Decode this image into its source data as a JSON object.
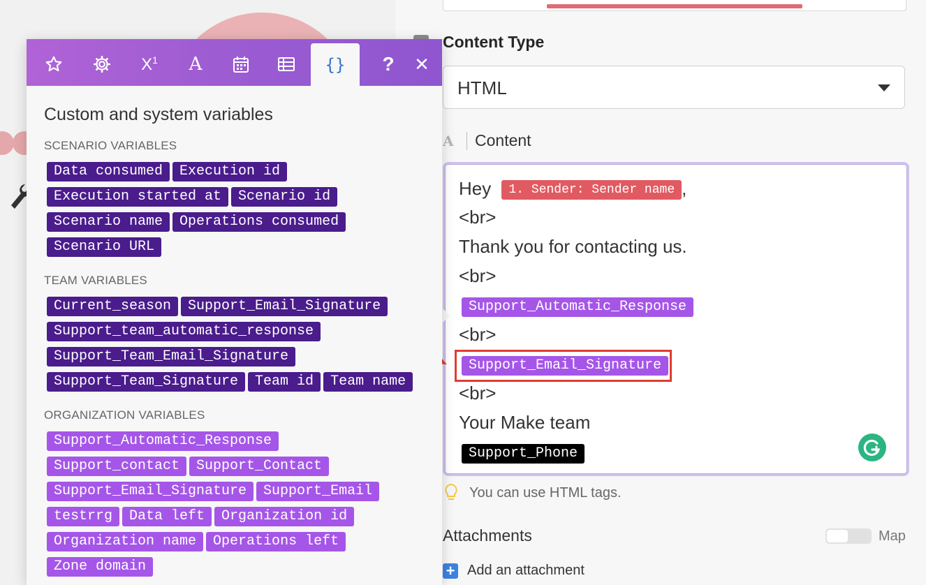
{
  "colors": {
    "scenario_pill": "#4a1c8c",
    "team_pill": "#4a1c8c",
    "org_pill": "#a556e8",
    "sender_pill": "#e15a61",
    "phone_pill": "#000000",
    "highlight": "#e03c31",
    "toolbar_gradient_start": "#b063d6",
    "toolbar_gradient_end": "#8f56cf"
  },
  "variables_panel": {
    "toolbar_icons": [
      "star-icon",
      "gear-icon",
      "superscript-icon",
      "text-icon",
      "calendar-icon",
      "table-icon",
      "braces-icon",
      "help-icon",
      "close-icon"
    ],
    "title": "Custom and system variables",
    "scenario": {
      "heading": "SCENARIO VARIABLES",
      "rows": [
        [
          "Data consumed",
          "Execution id"
        ],
        [
          "Execution started at",
          "Scenario id"
        ],
        [
          "Scenario name",
          "Operations consumed"
        ],
        [
          "Scenario URL"
        ]
      ]
    },
    "team": {
      "heading": "TEAM VARIABLES",
      "rows": [
        [
          "Current_season",
          "Support_Email_Signature"
        ],
        [
          "Support_team_automatic_response"
        ],
        [
          "Support_Team_Email_Signature"
        ],
        [
          "Support_Team_Signature",
          "Team id",
          "Team name"
        ]
      ]
    },
    "organization": {
      "heading": "ORGANIZATION VARIABLES",
      "rows": [
        [
          "Support_Automatic_Response"
        ],
        [
          "Support_contact",
          "Support_Contact"
        ],
        [
          "Support_Email_Signature",
          "Support_Email"
        ],
        [
          "testrrg",
          "Data left",
          "Organization id"
        ],
        [
          "Organization name",
          "Operations left"
        ],
        [
          "Zone domain"
        ]
      ]
    }
  },
  "form": {
    "content_type_label": "Content Type",
    "content_type_value": "HTML",
    "content_label": "Content",
    "content_mode_icon": "A",
    "editor": {
      "hey": "Hey",
      "sender_pill": "1. Sender: Sender name",
      "comma": ",",
      "br1": "<br>",
      "thanks": "Thank you for contacting us.",
      "br2": "<br>",
      "auto_pill": "Support_Automatic_Response",
      "br3": "<br>",
      "sig_pill": "Support_Email_Signature",
      "br4": "<br>",
      "your_team": "Your Make team",
      "phone_pill": "Support_Phone"
    },
    "hint": "You can use HTML tags.",
    "attachments_label": "Attachments",
    "map_label": "Map",
    "add_attachment": "Add an attachment"
  }
}
